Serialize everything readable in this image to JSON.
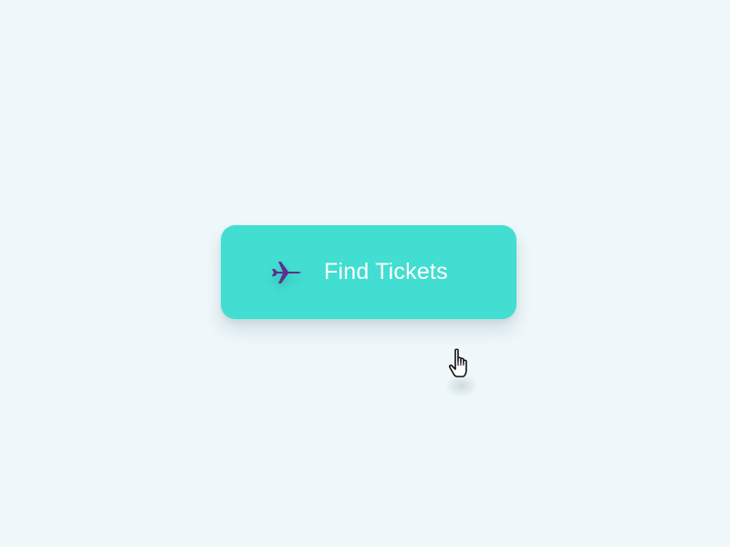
{
  "button": {
    "label": "Find Tickets",
    "icon": "airplane-icon"
  },
  "pointer": {
    "icon": "hand-pointer-icon"
  },
  "colors": {
    "background": "#eef7fa",
    "button": "#42ded1",
    "icon": "#5d2f8f",
    "label": "#ffffff"
  }
}
